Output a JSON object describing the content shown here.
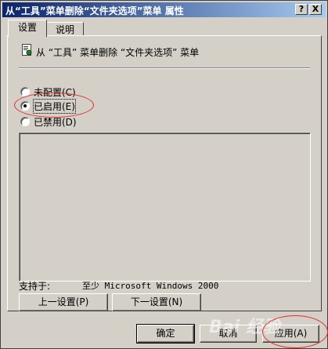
{
  "window": {
    "title": "从“工具”菜单删除“文件夹选项”菜单 属性",
    "help_label": "?",
    "close_label": "X"
  },
  "tabs": [
    {
      "label": "设置"
    },
    {
      "label": "说明"
    }
  ],
  "policy": {
    "name": "从 “工具” 菜单删除 “文件夹选项” 菜单"
  },
  "options": [
    {
      "label": "未配置(C)",
      "checked": false
    },
    {
      "label": "已启用(E)",
      "checked": true
    },
    {
      "label": "已禁用(D)",
      "checked": false
    }
  ],
  "supported": {
    "label": "支持于:",
    "value": "至少 Microsoft Windows 2000"
  },
  "nav": {
    "prev_label": "上一设置(P)",
    "next_label": "下一设置(N)"
  },
  "buttons": {
    "ok_label": "确定",
    "cancel_label": "取消",
    "apply_label": "应用(A)"
  },
  "watermark": "Bai 经验",
  "colors": {
    "titlebar_start": "#0a246a",
    "titlebar_end": "#a6caf0",
    "face": "#d4d0c8",
    "annotation": "#e03030"
  }
}
